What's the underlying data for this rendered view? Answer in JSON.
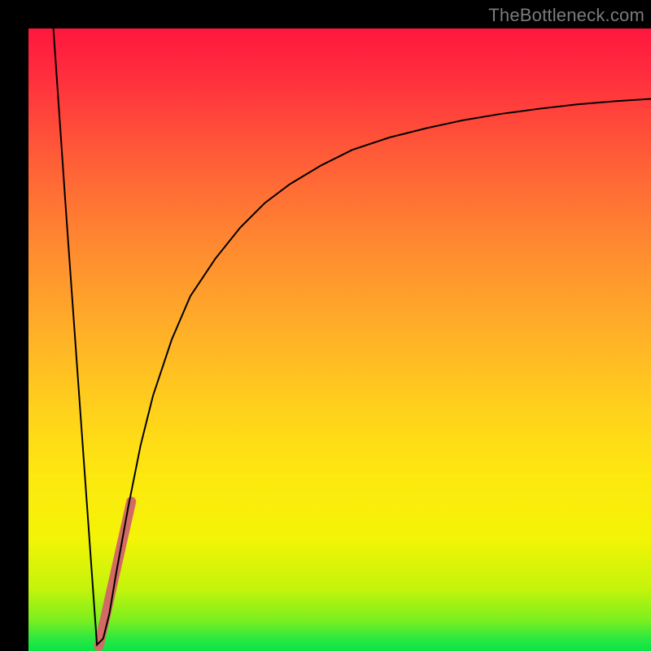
{
  "watermark": "TheBottleneck.com",
  "chart_data": {
    "type": "line",
    "title": "",
    "xlabel": "",
    "ylabel": "",
    "xlim": [
      0,
      100
    ],
    "ylim": [
      0,
      100
    ],
    "grid": false,
    "legend": false,
    "series": [
      {
        "name": "curve-main",
        "color": "#000000",
        "stroke_width": 2,
        "x": [
          4,
          6,
          8,
          10,
          11,
          12,
          13,
          14,
          16,
          18,
          20,
          23,
          26,
          30,
          34,
          38,
          42,
          47,
          52,
          58,
          64,
          70,
          76,
          82,
          88,
          94,
          100
        ],
        "y": [
          100,
          71,
          43,
          15,
          1,
          2,
          6,
          12,
          23,
          33,
          41,
          50,
          57,
          63,
          68,
          72,
          75,
          78,
          80.5,
          82.5,
          84,
          85.3,
          86.3,
          87.1,
          87.8,
          88.3,
          88.7
        ]
      },
      {
        "name": "highlight-segment",
        "color": "#d26b63",
        "stroke_width": 12,
        "linecap": "round",
        "x": [
          11.3,
          16.5
        ],
        "y": [
          0.8,
          24
        ]
      }
    ]
  }
}
